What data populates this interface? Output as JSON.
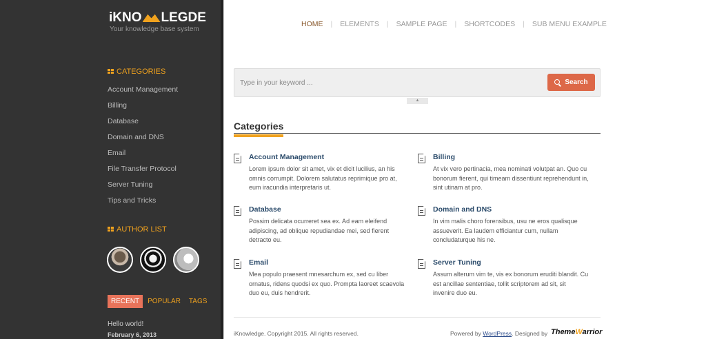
{
  "site": {
    "logo": {
      "left": "iKNO",
      "right": "LEGDE"
    },
    "tagline": "Your knowledge base system"
  },
  "nav": {
    "items": [
      "HOME",
      "ELEMENTS",
      "SAMPLE PAGE",
      "SHORTCODES",
      "SUB MENU EXAMPLE"
    ],
    "active": "HOME"
  },
  "sidebar": {
    "categories_heading": "CATEGORIES",
    "categories": [
      "Account Management",
      "Billing",
      "Database",
      "Domain and DNS",
      "Email",
      "File Transfer Protocol",
      "Server Tuning",
      "Tips and Tricks"
    ],
    "authors_heading": "AUTHOR LIST",
    "tabs": [
      "RECENT",
      "POPULAR",
      "TAGS"
    ],
    "active_tab": "RECENT",
    "recent_post": {
      "title": "Hello world!",
      "date": "February 6, 2013"
    }
  },
  "search": {
    "placeholder": "Type in your keyword ...",
    "button_label": "Search",
    "toggle_glyph": "▲"
  },
  "main": {
    "section_title": "Categories",
    "categories": [
      {
        "title": "Account Management",
        "desc": "Lorem ipsum dolor sit amet, vix et dicit lucilius, an his omnis corrumpit. Dolorem salutatus reprimique pro at, eum iracundia interpretaris ut."
      },
      {
        "title": "Billing",
        "desc": "At vix vero pertinacia, mea nominati volutpat an. Quo cu bonorum fierent, qui timeam dissentiunt reprehendunt in, sint utinam at pro."
      },
      {
        "title": "Database",
        "desc": "Possim delicata ocurreret sea ex. Ad eam eleifend adipiscing, ad oblique repudiandae mei, sed fierent detracto eu."
      },
      {
        "title": "Domain and DNS",
        "desc": "In vim malis choro forensibus, usu ne eros qualisque assueverit. Ea laudem efficiantur cum, nullam concludaturque his ne."
      },
      {
        "title": "Email",
        "desc": "Mea populo praesent mnesarchum ex, sed cu liber ornatus, ridens quodsi ex quo. Prompta laoreet scaevola duo eu, duis hendrerit."
      },
      {
        "title": "Server Tuning",
        "desc": "Assum alterum vim te, vis ex bonorum eruditi blandit. Cu est ancillae sententiae, tollit scriptorem ad sit, sit invenire duo eu."
      }
    ]
  },
  "footer": {
    "copyright": "iKnowledge. Copyright 2015. All rights reserved.",
    "powered_prefix": "Powered by ",
    "powered_link": "WordPress",
    "designed_by": ". Designed by",
    "brand_a": "Theme",
    "brand_b": "W",
    "brand_c": "arrior"
  },
  "colors": {
    "sidebar_bg": "#333333",
    "accent": "#f0a21e",
    "search_button": "#dd6848",
    "link_title": "#2a4a6a"
  }
}
